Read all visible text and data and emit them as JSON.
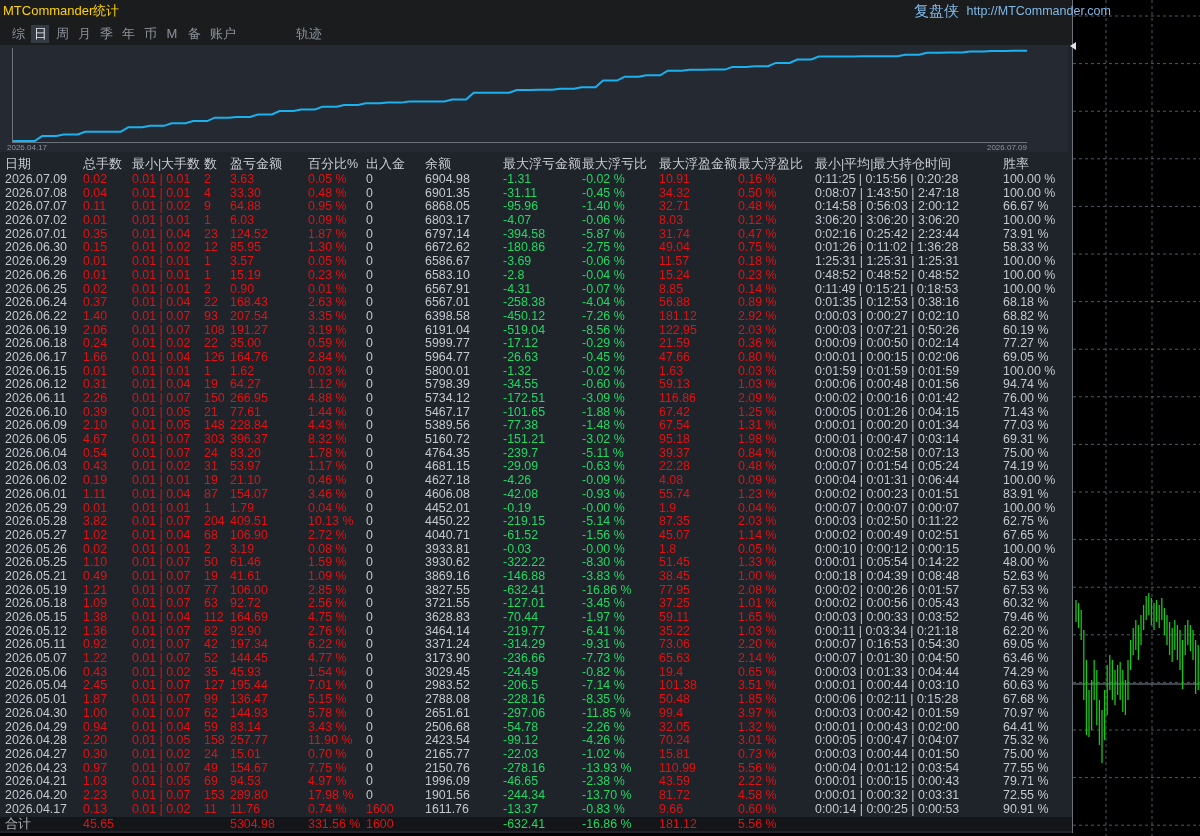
{
  "window": {
    "title": "MTCommander统计",
    "brand": "复盘侠",
    "link": "http://MTCommander.com"
  },
  "tabs": [
    {
      "label": "综",
      "selected": false
    },
    {
      "label": "日",
      "selected": true
    },
    {
      "label": "周",
      "selected": false
    },
    {
      "label": "月",
      "selected": false
    },
    {
      "label": "季",
      "selected": false
    },
    {
      "label": "年",
      "selected": false
    },
    {
      "label": "币",
      "selected": false
    },
    {
      "label": "M",
      "selected": false
    },
    {
      "label": "备",
      "selected": false
    },
    {
      "label": "账户",
      "selected": false
    }
  ],
  "track_button": {
    "label": "轨迹"
  },
  "equity_chart": {
    "start_label": "2026.04.17",
    "end_label": "2026.07.09"
  },
  "table": {
    "columns": [
      {
        "label": "日期",
        "kind": "date"
      },
      {
        "label": "总手数",
        "kind": "lots"
      },
      {
        "label": "最小|大手数",
        "kind": "lot_range"
      },
      {
        "label": "数",
        "kind": "trades"
      },
      {
        "label": "盈亏金额",
        "kind": "profit"
      },
      {
        "label": "百分比%",
        "kind": "percent"
      },
      {
        "label": "出入金",
        "kind": "deposit"
      },
      {
        "label": "余额",
        "kind": "balance"
      },
      {
        "label": "最大浮亏金额",
        "kind": "float_loss"
      },
      {
        "label": "最大浮亏比",
        "kind": "float_loss_pct"
      },
      {
        "label": "最大浮盈金额",
        "kind": "float_profit"
      },
      {
        "label": "最大浮盈比",
        "kind": "float_profit_pct"
      },
      {
        "label": "最小|平均|最大持仓时间",
        "kind": "hold_time"
      },
      {
        "label": "胜率",
        "kind": "win_rate"
      }
    ],
    "rows": [
      {
        "cells": [
          "2026.07.09",
          "0.02",
          "0.01 | 0.01",
          "2",
          "3.63",
          "0.05 %",
          "0",
          "6904.98",
          "-1.31",
          "-0.02 %",
          "10.91",
          "0.16 %",
          "0:11:25 | 0:15:56 | 0:20:28",
          "100.00 %"
        ],
        "deposit_highlighted": false
      },
      {
        "cells": [
          "2026.07.08",
          "0.04",
          "0.01 | 0.01",
          "4",
          "33.30",
          "0.48 %",
          "0",
          "6901.35",
          "-31.11",
          "-0.45 %",
          "34.32",
          "0.50 %",
          "0:08:07 | 1:43:50 | 2:47:18",
          "100.00 %"
        ],
        "deposit_highlighted": false
      },
      {
        "cells": [
          "2026.07.07",
          "0.11",
          "0.01 | 0.02",
          "9",
          "64.88",
          "0.95 %",
          "0",
          "6868.05",
          "-95.96",
          "-1.40 %",
          "32.71",
          "0.48 %",
          "0:14:58 | 0:56:03 | 2:00:12",
          "66.67 %"
        ],
        "deposit_highlighted": false
      },
      {
        "cells": [
          "2026.07.02",
          "0.01",
          "0.01 | 0.01",
          "1",
          "6.03",
          "0.09 %",
          "0",
          "6803.17",
          "-4.07",
          "-0.06 %",
          "8.03",
          "0.12 %",
          "3:06:20 | 3:06:20 | 3:06:20",
          "100.00 %"
        ],
        "deposit_highlighted": false
      },
      {
        "cells": [
          "2026.07.01",
          "0.35",
          "0.01 | 0.04",
          "23",
          "124.52",
          "1.87 %",
          "0",
          "6797.14",
          "-394.58",
          "-5.87 %",
          "31.74",
          "0.47 %",
          "0:02:16 | 0:25:42 | 2:23:44",
          "73.91 %"
        ],
        "deposit_highlighted": false
      },
      {
        "cells": [
          "2026.06.30",
          "0.15",
          "0.01 | 0.02",
          "12",
          "85.95",
          "1.30 %",
          "0",
          "6672.62",
          "-180.86",
          "-2.75 %",
          "49.04",
          "0.75 %",
          "0:01:26 | 0:11:02 | 1:36:28",
          "58.33 %"
        ],
        "deposit_highlighted": false
      },
      {
        "cells": [
          "2026.06.29",
          "0.01",
          "0.01 | 0.01",
          "1",
          "3.57",
          "0.05 %",
          "0",
          "6586.67",
          "-3.69",
          "-0.06 %",
          "11.57",
          "0.18 %",
          "1:25:31 | 1:25:31 | 1:25:31",
          "100.00 %"
        ],
        "deposit_highlighted": false
      },
      {
        "cells": [
          "2026.06.26",
          "0.01",
          "0.01 | 0.01",
          "1",
          "15.19",
          "0.23 %",
          "0",
          "6583.10",
          "-2.8",
          "-0.04 %",
          "15.24",
          "0.23 %",
          "0:48:52 | 0:48:52 | 0:48:52",
          "100.00 %"
        ],
        "deposit_highlighted": false
      },
      {
        "cells": [
          "2026.06.25",
          "0.02",
          "0.01 | 0.01",
          "2",
          "0.90",
          "0.01 %",
          "0",
          "6567.91",
          "-4.31",
          "-0.07 %",
          "8.85",
          "0.14 %",
          "0:11:49 | 0:15:21 | 0:18:53",
          "100.00 %"
        ],
        "deposit_highlighted": false
      },
      {
        "cells": [
          "2026.06.24",
          "0.37",
          "0.01 | 0.04",
          "22",
          "168.43",
          "2.63 %",
          "0",
          "6567.01",
          "-258.38",
          "-4.04 %",
          "56.88",
          "0.89 %",
          "0:01:35 | 0:12:53 | 0:38:16",
          "68.18 %"
        ],
        "deposit_highlighted": false
      },
      {
        "cells": [
          "2026.06.22",
          "1.40",
          "0.01 | 0.07",
          "93",
          "207.54",
          "3.35 %",
          "0",
          "6398.58",
          "-450.12",
          "-7.26 %",
          "181.12",
          "2.92 %",
          "0:00:03 | 0:00:27 | 0:02:10",
          "68.82 %"
        ],
        "deposit_highlighted": false
      },
      {
        "cells": [
          "2026.06.19",
          "2.06",
          "0.01 | 0.07",
          "108",
          "191.27",
          "3.19 %",
          "0",
          "6191.04",
          "-519.04",
          "-8.56 %",
          "122.95",
          "2.03 %",
          "0:00:03 | 0:07:21 | 0:50:26",
          "60.19 %"
        ],
        "deposit_highlighted": false
      },
      {
        "cells": [
          "2026.06.18",
          "0.24",
          "0.01 | 0.02",
          "22",
          "35.00",
          "0.59 %",
          "0",
          "5999.77",
          "-17.12",
          "-0.29 %",
          "21.59",
          "0.36 %",
          "0:00:09 | 0:00:50 | 0:02:14",
          "77.27 %"
        ],
        "deposit_highlighted": false
      },
      {
        "cells": [
          "2026.06.17",
          "1.66",
          "0.01 | 0.04",
          "126",
          "164.76",
          "2.84 %",
          "0",
          "5964.77",
          "-26.63",
          "-0.45 %",
          "47.66",
          "0.80 %",
          "0:00:01 | 0:00:15 | 0:02:06",
          "69.05 %"
        ],
        "deposit_highlighted": false
      },
      {
        "cells": [
          "2026.06.15",
          "0.01",
          "0.01 | 0.01",
          "1",
          "1.62",
          "0.03 %",
          "0",
          "5800.01",
          "-1.32",
          "-0.02 %",
          "1.63",
          "0.03 %",
          "0:01:59 | 0:01:59 | 0:01:59",
          "100.00 %"
        ],
        "deposit_highlighted": false
      },
      {
        "cells": [
          "2026.06.12",
          "0.31",
          "0.01 | 0.04",
          "19",
          "64.27",
          "1.12 %",
          "0",
          "5798.39",
          "-34.55",
          "-0.60 %",
          "59.13",
          "1.03 %",
          "0:00:06 | 0:00:48 | 0:01:56",
          "94.74 %"
        ],
        "deposit_highlighted": false
      },
      {
        "cells": [
          "2026.06.11",
          "2.26",
          "0.01 | 0.07",
          "150",
          "266.95",
          "4.88 %",
          "0",
          "5734.12",
          "-172.51",
          "-3.09 %",
          "116.86",
          "2.09 %",
          "0:00:02 | 0:00:16 | 0:01:42",
          "76.00 %"
        ],
        "deposit_highlighted": false
      },
      {
        "cells": [
          "2026.06.10",
          "0.39",
          "0.01 | 0.05",
          "21",
          "77.61",
          "1.44 %",
          "0",
          "5467.17",
          "-101.65",
          "-1.88 %",
          "67.42",
          "1.25 %",
          "0:00:05 | 0:01:26 | 0:04:15",
          "71.43 %"
        ],
        "deposit_highlighted": false
      },
      {
        "cells": [
          "2026.06.09",
          "2.10",
          "0.01 | 0.05",
          "148",
          "228.84",
          "4.43 %",
          "0",
          "5389.56",
          "-77.38",
          "-1.48 %",
          "67.54",
          "1.31 %",
          "0:00:01 | 0:00:20 | 0:01:34",
          "77.03 %"
        ],
        "deposit_highlighted": false
      },
      {
        "cells": [
          "2026.06.05",
          "4.67",
          "0.01 | 0.07",
          "303",
          "396.37",
          "8.32 %",
          "0",
          "5160.72",
          "-151.21",
          "-3.02 %",
          "95.18",
          "1.98 %",
          "0:00:01 | 0:00:47 | 0:03:14",
          "69.31 %"
        ],
        "deposit_highlighted": false
      },
      {
        "cells": [
          "2026.06.04",
          "0.54",
          "0.01 | 0.07",
          "24",
          "83.20",
          "1.78 %",
          "0",
          "4764.35",
          "-239.7",
          "-5.11 %",
          "39.37",
          "0.84 %",
          "0:00:08 | 0:02:58 | 0:07:13",
          "75.00 %"
        ],
        "deposit_highlighted": false
      },
      {
        "cells": [
          "2026.06.03",
          "0.43",
          "0.01 | 0.02",
          "31",
          "53.97",
          "1.17 %",
          "0",
          "4681.15",
          "-29.09",
          "-0.63 %",
          "22.28",
          "0.48 %",
          "0:00:07 | 0:01:54 | 0:05:24",
          "74.19 %"
        ],
        "deposit_highlighted": false
      },
      {
        "cells": [
          "2026.06.02",
          "0.19",
          "0.01 | 0.01",
          "19",
          "21.10",
          "0.46 %",
          "0",
          "4627.18",
          "-4.26",
          "-0.09 %",
          "4.08",
          "0.09 %",
          "0:00:04 | 0:01:31 | 0:06:44",
          "100.00 %"
        ],
        "deposit_highlighted": false
      },
      {
        "cells": [
          "2026.06.01",
          "1.11",
          "0.01 | 0.04",
          "87",
          "154.07",
          "3.46 %",
          "0",
          "4606.08",
          "-42.08",
          "-0.93 %",
          "55.74",
          "1.23 %",
          "0:00:02 | 0:00:23 | 0:01:51",
          "83.91 %"
        ],
        "deposit_highlighted": false
      },
      {
        "cells": [
          "2026.05.29",
          "0.01",
          "0.01 | 0.01",
          "1",
          "1.79",
          "0.04 %",
          "0",
          "4452.01",
          "-0.19",
          "-0.00 %",
          "1.9",
          "0.04 %",
          "0:00:07 | 0:00:07 | 0:00:07",
          "100.00 %"
        ],
        "deposit_highlighted": false
      },
      {
        "cells": [
          "2026.05.28",
          "3.82",
          "0.01 | 0.07",
          "204",
          "409.51",
          "10.13 %",
          "0",
          "4450.22",
          "-219.15",
          "-5.14 %",
          "87.35",
          "2.03 %",
          "0:00:03 | 0:02:50 | 0:11:22",
          "62.75 %"
        ],
        "deposit_highlighted": false
      },
      {
        "cells": [
          "2026.05.27",
          "1.02",
          "0.01 | 0.04",
          "68",
          "106.90",
          "2.72 %",
          "0",
          "4040.71",
          "-61.52",
          "-1.56 %",
          "45.07",
          "1.14 %",
          "0:00:02 | 0:00:49 | 0:02:51",
          "67.65 %"
        ],
        "deposit_highlighted": false
      },
      {
        "cells": [
          "2026.05.26",
          "0.02",
          "0.01 | 0.01",
          "2",
          "3.19",
          "0.08 %",
          "0",
          "3933.81",
          "-0.03",
          "-0.00 %",
          "1.8",
          "0.05 %",
          "0:00:10 | 0:00:12 | 0:00:15",
          "100.00 %"
        ],
        "deposit_highlighted": false
      },
      {
        "cells": [
          "2026.05.25",
          "1.10",
          "0.01 | 0.07",
          "50",
          "61.46",
          "1.59 %",
          "0",
          "3930.62",
          "-322.22",
          "-8.30 %",
          "51.45",
          "1.33 %",
          "0:00:01 | 0:05:54 | 0:14:22",
          "48.00 %"
        ],
        "deposit_highlighted": false
      },
      {
        "cells": [
          "2026.05.21",
          "0.49",
          "0.01 | 0.07",
          "19",
          "41.61",
          "1.09 %",
          "0",
          "3869.16",
          "-146.88",
          "-3.83 %",
          "38.45",
          "1.00 %",
          "0:00:18 | 0:04:39 | 0:08:48",
          "52.63 %"
        ],
        "deposit_highlighted": false
      },
      {
        "cells": [
          "2026.05.19",
          "1.21",
          "0.01 | 0.07",
          "77",
          "106.00",
          "2.85 %",
          "0",
          "3827.55",
          "-632.41",
          "-16.86 %",
          "77.95",
          "2.08 %",
          "0:00:02 | 0:00:26 | 0:01:57",
          "67.53 %"
        ],
        "deposit_highlighted": false
      },
      {
        "cells": [
          "2026.05.18",
          "1.09",
          "0.01 | 0.07",
          "63",
          "92.72",
          "2.56 %",
          "0",
          "3721.55",
          "-127.01",
          "-3.45 %",
          "37.25",
          "1.01 %",
          "0:00:02 | 0:00:56 | 0:05:43",
          "60.32 %"
        ],
        "deposit_highlighted": false
      },
      {
        "cells": [
          "2026.05.15",
          "1.38",
          "0.01 | 0.04",
          "112",
          "164.69",
          "4.75 %",
          "0",
          "3628.83",
          "-70.44",
          "-1.97 %",
          "59.11",
          "1.65 %",
          "0:00:03 | 0:00:33 | 0:03:52",
          "79.46 %"
        ],
        "deposit_highlighted": false
      },
      {
        "cells": [
          "2026.05.12",
          "1.36",
          "0.01 | 0.07",
          "82",
          "92.90",
          "2.76 %",
          "0",
          "3464.14",
          "-219.77",
          "-6.41 %",
          "35.22",
          "1.03 %",
          "0:00:11 | 0:03:34 | 0:21:18",
          "62.20 %"
        ],
        "deposit_highlighted": false
      },
      {
        "cells": [
          "2026.05.11",
          "0.92",
          "0.01 | 0.07",
          "42",
          "197.34",
          "6.22 %",
          "0",
          "3371.24",
          "-314.29",
          "-9.31 %",
          "73.06",
          "2.20 %",
          "0:00:07 | 0:16:53 | 0:54:30",
          "69.05 %"
        ],
        "deposit_highlighted": false
      },
      {
        "cells": [
          "2026.05.07",
          "1.22",
          "0.01 | 0.07",
          "52",
          "144.45",
          "4.77 %",
          "0",
          "3173.90",
          "-236.66",
          "-7.73 %",
          "65.63",
          "2.14 %",
          "0:00:07 | 0:01:30 | 0:04:50",
          "63.46 %"
        ],
        "deposit_highlighted": false
      },
      {
        "cells": [
          "2026.05.06",
          "0.43",
          "0.01 | 0.02",
          "35",
          "45.93",
          "1.54 %",
          "0",
          "3029.45",
          "-24.49",
          "-0.82 %",
          "19.4",
          "0.65 %",
          "0:00:03 | 0:01:33 | 0:04:44",
          "74.29 %"
        ],
        "deposit_highlighted": false
      },
      {
        "cells": [
          "2026.05.04",
          "2.45",
          "0.01 | 0.07",
          "127",
          "195.44",
          "7.01 %",
          "0",
          "2983.52",
          "-206.5",
          "-7.14 %",
          "101.38",
          "3.51 %",
          "0:00:01 | 0:00:44 | 0:03:10",
          "60.63 %"
        ],
        "deposit_highlighted": false
      },
      {
        "cells": [
          "2026.05.01",
          "1.87",
          "0.01 | 0.07",
          "99",
          "136.47",
          "5.15 %",
          "0",
          "2788.08",
          "-228.16",
          "-8.35 %",
          "50.48",
          "1.85 %",
          "0:00:06 | 0:02:11 | 0:15:28",
          "67.68 %"
        ],
        "deposit_highlighted": false
      },
      {
        "cells": [
          "2026.04.30",
          "1.00",
          "0.01 | 0.07",
          "62",
          "144.93",
          "5.78 %",
          "0",
          "2651.61",
          "-297.06",
          "-11.85 %",
          "99.4",
          "3.97 %",
          "0:00:03 | 0:00:42 | 0:01:59",
          "70.97 %"
        ],
        "deposit_highlighted": false
      },
      {
        "cells": [
          "2026.04.29",
          "0.94",
          "0.01 | 0.04",
          "59",
          "83.14",
          "3.43 %",
          "0",
          "2506.68",
          "-54.78",
          "-2.26 %",
          "32.05",
          "1.32 %",
          "0:00:01 | 0:00:43 | 0:02:00",
          "64.41 %"
        ],
        "deposit_highlighted": false
      },
      {
        "cells": [
          "2026.04.28",
          "2.20",
          "0.01 | 0.05",
          "158",
          "257.77",
          "11.90 %",
          "0",
          "2423.54",
          "-99.12",
          "-4.26 %",
          "70.24",
          "3.01 %",
          "0:00:05 | 0:00:47 | 0:04:07",
          "75.32 %"
        ],
        "deposit_highlighted": false
      },
      {
        "cells": [
          "2026.04.27",
          "0.30",
          "0.01 | 0.02",
          "24",
          "15.01",
          "0.70 %",
          "0",
          "2165.77",
          "-22.03",
          "-1.02 %",
          "15.81",
          "0.73 %",
          "0:00:03 | 0:00:44 | 0:01:50",
          "75.00 %"
        ],
        "deposit_highlighted": false
      },
      {
        "cells": [
          "2026.04.23",
          "0.97",
          "0.01 | 0.07",
          "49",
          "154.67",
          "7.75 %",
          "0",
          "2150.76",
          "-278.16",
          "-13.93 %",
          "110.99",
          "5.56 %",
          "0:00:04 | 0:01:12 | 0:03:54",
          "77.55 %"
        ],
        "deposit_highlighted": false
      },
      {
        "cells": [
          "2026.04.21",
          "1.03",
          "0.01 | 0.05",
          "69",
          "94.53",
          "4.97 %",
          "0",
          "1996.09",
          "-46.65",
          "-2.38 %",
          "43.59",
          "2.22 %",
          "0:00:01 | 0:00:15 | 0:00:43",
          "79.71 %"
        ],
        "deposit_highlighted": false
      },
      {
        "cells": [
          "2026.04.20",
          "2.23",
          "0.01 | 0.07",
          "153",
          "289.80",
          "17.98 %",
          "0",
          "1901.56",
          "-244.34",
          "-13.70 %",
          "81.72",
          "4.58 %",
          "0:00:01 | 0:00:32 | 0:03:31",
          "72.55 %"
        ],
        "deposit_highlighted": false
      },
      {
        "cells": [
          "2026.04.17",
          "0.13",
          "0.01 | 0.02",
          "11",
          "11.76",
          "0.74 %",
          "1600",
          "1611.76",
          "-13.37",
          "-0.83 %",
          "9.66",
          "0.60 %",
          "0:00:14 | 0:00:25 | 0:00:53",
          "90.91 %"
        ],
        "deposit_highlighted": true
      }
    ],
    "total": {
      "label": "合计",
      "lots": "45.65",
      "profit": "5304.98",
      "percent": "331.56 %",
      "deposit": "1600",
      "deposit_highlighted": true,
      "float_loss": "-632.41",
      "float_loss_pct": "-16.86 %",
      "float_profit": "181.12",
      "float_profit_pct": "5.56 %"
    }
  }
}
